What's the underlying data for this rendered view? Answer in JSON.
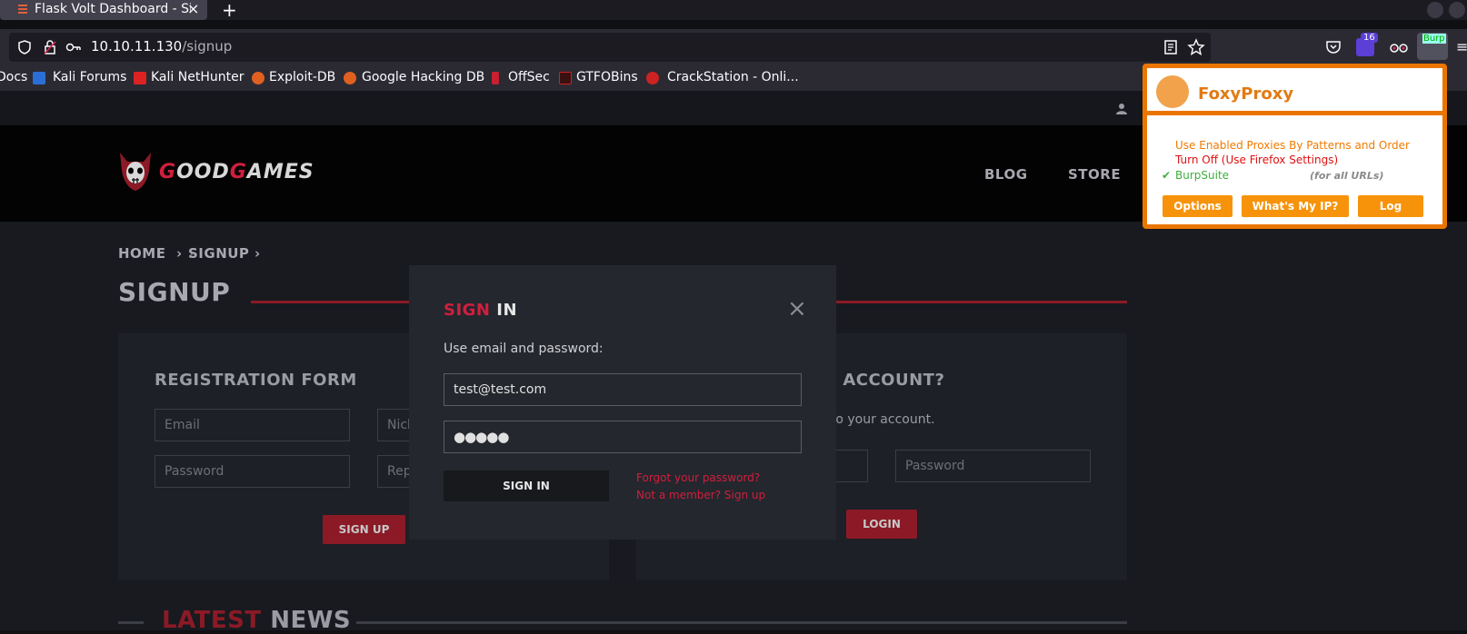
{
  "browser": {
    "tab_title": "Flask Volt Dashboard - Si",
    "new_tab": "+",
    "url_host": "10.10.11.130",
    "url_path": "/signup",
    "bookmarks": [
      {
        "label": "Docs"
      },
      {
        "label": "Kali Forums"
      },
      {
        "label": "Kali NetHunter"
      },
      {
        "label": "Exploit-DB"
      },
      {
        "label": "Google Hacking DB"
      },
      {
        "label": "OffSec"
      },
      {
        "label": "GTFOBins"
      },
      {
        "label": "CrackStation - Onli..."
      }
    ],
    "ext_badge": "16",
    "burp_label": "Burp"
  },
  "site": {
    "logo_first": "G",
    "logo_mid1": "OOD",
    "logo_second": "G",
    "logo_rest": "AMES",
    "nav": {
      "blog": "BLOG",
      "store": "STORE"
    },
    "breadcrumb": {
      "home": "HOME",
      "current": "SIGNUP"
    },
    "page_title": "SIGNUP",
    "registration": {
      "title": "REGISTRATION FORM",
      "email_placeholder": "Email",
      "nick_placeholder": "Nick",
      "password_placeholder": "Password",
      "repeat_placeholder": "Rep",
      "button": "SIGN UP"
    },
    "login_panel": {
      "title_fragment": "N ACCOUNT?",
      "desc_fragment": "nto your account.",
      "password_placeholder": "Password",
      "button": "LOGIN"
    },
    "news": {
      "part1": "LATEST",
      "part2": "NEWS"
    }
  },
  "modal": {
    "title_red": "SIGN",
    "title_white": "IN",
    "close": "×",
    "subtitle": "Use email and password:",
    "email_value": "test@test.com",
    "password_value": "●●●●●",
    "button": "SIGN IN",
    "forgot": "Forgot your password?",
    "signup_link": "Not a member? Sign up"
  },
  "foxyproxy": {
    "title": "FoxyProxy",
    "item1": "Use Enabled Proxies By Patterns and Order",
    "item2": "Turn Off (Use Firefox Settings)",
    "item3_check": "✔",
    "item3": "BurpSuite",
    "item3_note": "(for all URLs)",
    "btn_options": "Options",
    "btn_ip": "What's My IP?",
    "btn_log": "Log"
  },
  "colors": {
    "accent_red": "#d11e3e",
    "foxy_orange": "#f7930a"
  }
}
